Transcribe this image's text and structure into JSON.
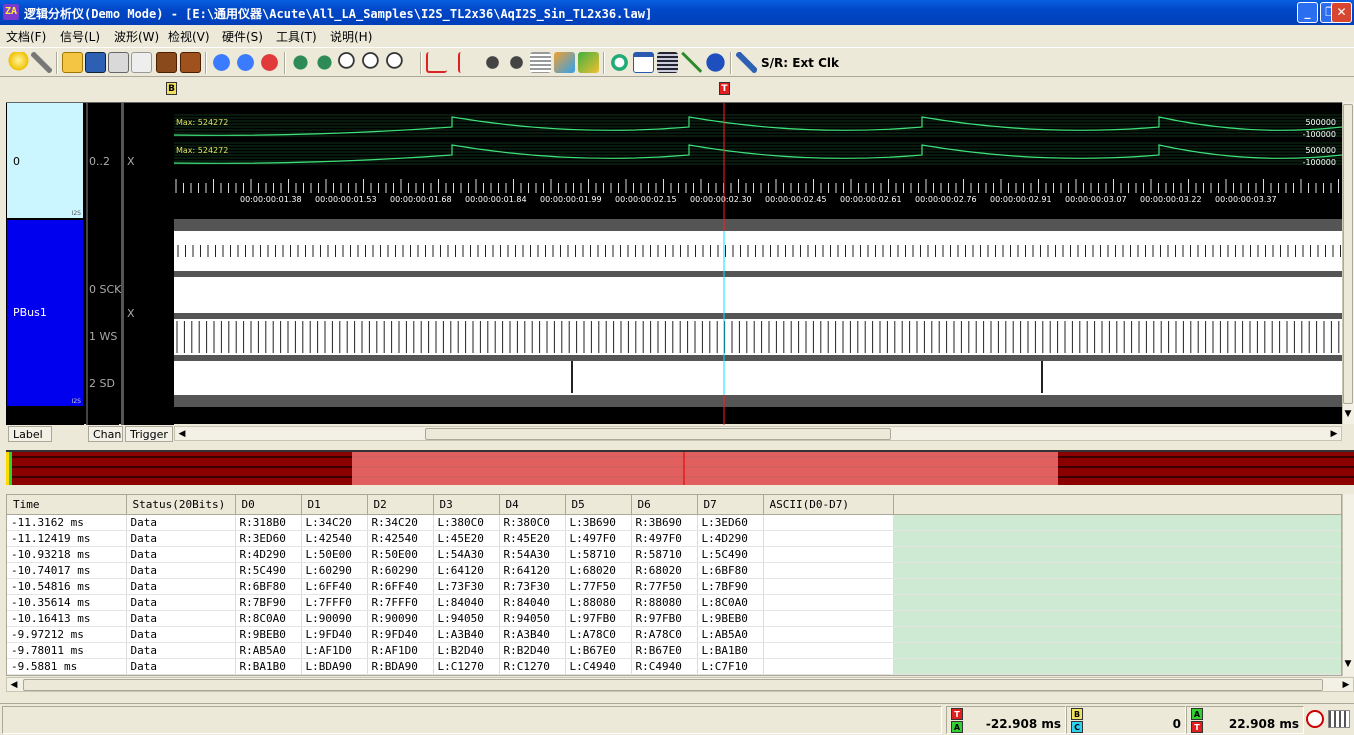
{
  "window": {
    "title": "逻辑分析仪(Demo Mode) - [E:\\通用仪器\\Acute\\All_LA_Samples\\I2S_TL2x36\\AqI2S_Sin_TL2x36.law]",
    "app_icon_text": "ZA",
    "minimize": "_",
    "restore": "❐",
    "close": "✕"
  },
  "menu": [
    "文档(F)",
    "信号(L)",
    "波形(W)",
    "检视(V)",
    "硬件(S)",
    "工具(T)",
    "说明(H)"
  ],
  "toolbar": {
    "sr_label": "S/R: Ext Clk"
  },
  "markers": {
    "b": "B",
    "t": "T"
  },
  "labels": {
    "group0": "0",
    "group0_sub": "I2S",
    "group1": "PBus1",
    "group1_sub": "I2S"
  },
  "channels": {
    "c0": "0..2",
    "c1": "0 SCK",
    "c2": "1 WS",
    "c3": "2 SD"
  },
  "trigger": {
    "t0": "X",
    "t1": "X"
  },
  "analog": {
    "max_label_1": "Max: 524272",
    "max_label_2": "Max: 524272",
    "scale_hi_1": "500000",
    "scale_lo_1": "-100000",
    "scale_hi_2": "500000",
    "scale_lo_2": "-100000"
  },
  "time_ticks": [
    "00:00:00:01.38",
    "00:00:00:01.53",
    "00:00:00:01.68",
    "00:00:00:01.84",
    "00:00:00:01.99",
    "00:00:00:02.15",
    "00:00:00:02.30",
    "00:00:00:02.45",
    "00:00:00:02.61",
    "00:00:00:02.76",
    "00:00:00:02.91",
    "00:00:00:03.07",
    "00:00:00:03.22",
    "00:00:00:03.37"
  ],
  "column_headers": {
    "label": "Label",
    "chan": "Chan",
    "trigger": "Trigger"
  },
  "table": {
    "headers": [
      "Time",
      "Status(20Bits)",
      "D0",
      "D1",
      "D2",
      "D3",
      "D4",
      "D5",
      "D6",
      "D7",
      "ASCII(D0-D7)"
    ],
    "rows": [
      [
        "-11.3162 ms",
        "Data",
        "R:318B0",
        "L:34C20",
        "R:34C20",
        "L:380C0",
        "R:380C0",
        "L:3B690",
        "R:3B690",
        "L:3ED60",
        ""
      ],
      [
        "-11.12419 ms",
        "Data",
        "R:3ED60",
        "L:42540",
        "R:42540",
        "L:45E20",
        "R:45E20",
        "L:497F0",
        "R:497F0",
        "L:4D290",
        ""
      ],
      [
        "-10.93218 ms",
        "Data",
        "R:4D290",
        "L:50E00",
        "R:50E00",
        "L:54A30",
        "R:54A30",
        "L:58710",
        "R:58710",
        "L:5C490",
        ""
      ],
      [
        "-10.74017 ms",
        "Data",
        "R:5C490",
        "L:60290",
        "R:60290",
        "L:64120",
        "R:64120",
        "L:68020",
        "R:68020",
        "L:6BF80",
        ""
      ],
      [
        "-10.54816 ms",
        "Data",
        "R:6BF80",
        "L:6FF40",
        "R:6FF40",
        "L:73F30",
        "R:73F30",
        "L:77F50",
        "R:77F50",
        "L:7BF90",
        ""
      ],
      [
        "-10.35614 ms",
        "Data",
        "R:7BF90",
        "L:7FFF0",
        "R:7FFF0",
        "L:84040",
        "R:84040",
        "L:88080",
        "R:88080",
        "L:8C0A0",
        ""
      ],
      [
        "-10.16413 ms",
        "Data",
        "R:8C0A0",
        "L:90090",
        "R:90090",
        "L:94050",
        "R:94050",
        "L:97FB0",
        "R:97FB0",
        "L:9BEB0",
        ""
      ],
      [
        "-9.97212 ms",
        "Data",
        "R:9BEB0",
        "L:9FD40",
        "R:9FD40",
        "L:A3B40",
        "R:A3B40",
        "L:A78C0",
        "R:A78C0",
        "L:AB5A0",
        ""
      ],
      [
        "-9.78011 ms",
        "Data",
        "R:AB5A0",
        "L:AF1D0",
        "R:AF1D0",
        "L:B2D40",
        "R:B2D40",
        "L:B67E0",
        "R:B67E0",
        "L:BA1B0",
        ""
      ],
      [
        "-9.5881 ms",
        "Data",
        "R:BA1B0",
        "L:BDA90",
        "R:BDA90",
        "L:C1270",
        "R:C1270",
        "L:C4940",
        "R:C4940",
        "L:C7F10",
        ""
      ]
    ]
  },
  "status": {
    "ta_tag_top": "T",
    "ta_tag_bottom": "A",
    "ta_value": "-22.908 ms",
    "bc_tag_top": "B",
    "bc_tag_bottom": "C",
    "bc_value": "0",
    "at_tag_top": "A",
    "at_tag_bottom": "T",
    "at_value": "22.908 ms"
  },
  "colors": {
    "analog_trace": "#3fe07a",
    "trigger_line": "#ff2020",
    "cursor_line": "#00e5ff",
    "overview_dark": "#8b0000",
    "overview_light": "#f07070"
  }
}
